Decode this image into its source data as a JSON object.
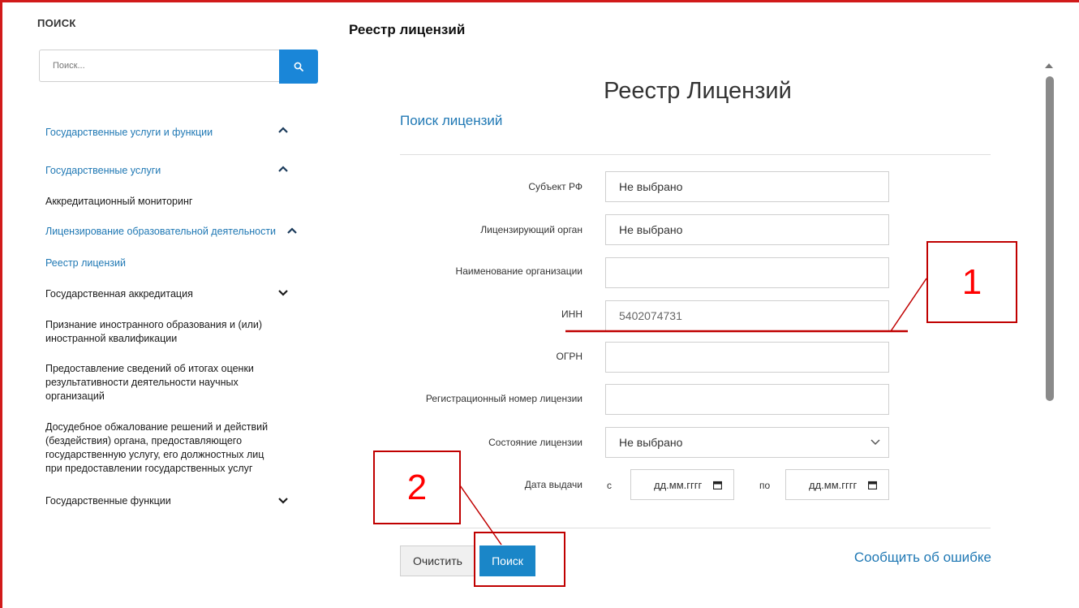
{
  "sidebar": {
    "search_heading": "ПОИСК",
    "search_placeholder": "Поиск...",
    "items": [
      {
        "label": "Государственные услуги и функции",
        "style": "link",
        "chevron": "up"
      },
      {
        "label": "Государственные услуги",
        "style": "link",
        "chevron": "up"
      },
      {
        "label": "Аккредитационный мониторинг",
        "style": "plain",
        "chevron": ""
      },
      {
        "label": "Лицензирование образовательной деятельности",
        "style": "link",
        "chevron": "up"
      },
      {
        "label": "Реестр лицензий",
        "style": "link",
        "chevron": ""
      },
      {
        "label": "Государственная аккредитация",
        "style": "plain",
        "chevron": "down"
      },
      {
        "label": "Признание иностранного образования и (или) иностранной квалификации",
        "style": "plain",
        "chevron": ""
      },
      {
        "label": "Предоставление сведений об итогах оценки результативности деятельности научных организаций",
        "style": "plain",
        "chevron": ""
      },
      {
        "label": "Досудебное обжалование решений и действий (бездействия) органа, предоставляющего государственную услугу, его должностных лиц при предоставлении государственных услуг",
        "style": "plain",
        "chevron": ""
      },
      {
        "label": "Государственные функции",
        "style": "plain",
        "chevron": "down"
      }
    ]
  },
  "main": {
    "page_title": "Реестр лицензий",
    "registry_title": "Реестр Лицензий",
    "section_title": "Поиск лицензий",
    "form": {
      "subject_label": "Субъект РФ",
      "subject_value": "Не выбрано",
      "authority_label": "Лицензирующий орган",
      "authority_value": "Не выбрано",
      "org_name_label": "Наименование организации",
      "org_name_value": "",
      "inn_label": "ИНН",
      "inn_value": "5402074731",
      "ogrn_label": "ОГРН",
      "ogrn_value": "",
      "reg_number_label": "Регистрационный номер лицензии",
      "reg_number_value": "",
      "status_label": "Состояние лицензии",
      "status_value": "Не выбрано",
      "issue_date_label": "Дата выдачи",
      "date_from_label": "с",
      "date_from_value": "дд.мм.гггг",
      "date_to_label": "по",
      "date_to_value": "дд.мм.гггг"
    },
    "clear_button": "Очистить",
    "search_button": "Поиск",
    "report_link": "Сообщить об ошибке"
  },
  "annotations": {
    "marker_1": "1",
    "marker_2": "2",
    "color": "#c00000"
  },
  "colors": {
    "accent": "#1a86c8",
    "link": "#1f78b4",
    "frame": "#d11a1a"
  }
}
